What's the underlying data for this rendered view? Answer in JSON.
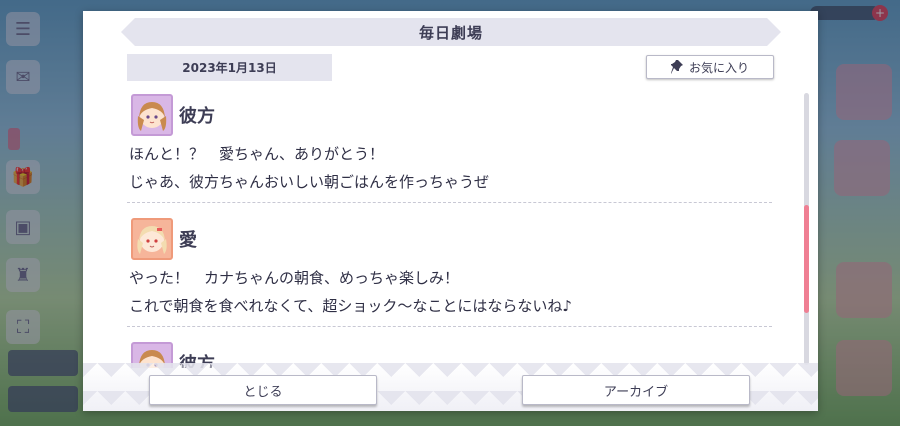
{
  "dialog": {
    "title": "毎日劇場",
    "date": "2023年1月13日",
    "favorite_label": "お気に入り",
    "close_label": "とじる",
    "archive_label": "アーカイブ"
  },
  "entries": [
    {
      "speaker": "彼方",
      "avatar": "kanata-avatar",
      "lines": [
        "ほんと！？　愛ちゃん、ありがとう！",
        "じゃあ、彼方ちゃんおいしい朝ごはんを作っちゃうぜ"
      ]
    },
    {
      "speaker": "愛",
      "avatar": "ai-avatar",
      "lines": [
        "やった！　カナちゃんの朝食、めっちゃ楽しみ！",
        "これで朝食を食べれなくて、超ショック～なことにはならないね♪"
      ]
    },
    {
      "speaker": "彼方",
      "avatar": "kanata-avatar",
      "lines": []
    }
  ],
  "scroll": {
    "position_fraction": 0.55
  },
  "colors": {
    "accent": "#ef7f93",
    "title_bar": "#e4e4ee",
    "text": "#3d3d55"
  }
}
